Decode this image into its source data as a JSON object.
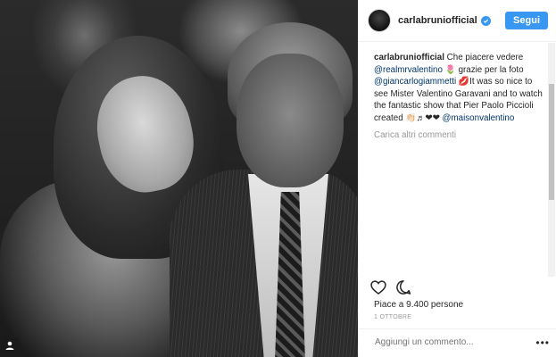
{
  "post": {
    "username": "carlabruniofficial",
    "follow_label": "Segui",
    "caption": {
      "author": "carlabruniofficial",
      "t1": " Che piacere vedere ",
      "m1": "@realmrvalentino",
      "t2": " 🌷 grazie per la foto ",
      "m2": "@giancarlogiammetti",
      "t3": " 💋It was so nice to see Mister Valentino Garavani and to watch the fantastic show that Pier Paolo Piccioli created 👏🏻♬❤❤ ",
      "m3": "@maisonvalentino"
    },
    "load_more": "Carica altri commenti",
    "likes": "Piace a 9.400 persone",
    "date": "1 OTTOBRE",
    "comment_placeholder": "Aggiungi un commento...",
    "more_label": "•••"
  },
  "icons": {
    "verified": "verified-badge-icon",
    "like": "heart-icon",
    "comment": "comment-icon",
    "tag": "user-tag-icon"
  },
  "colors": {
    "accent": "#3897f0",
    "link": "#003569",
    "muted": "#999999"
  }
}
